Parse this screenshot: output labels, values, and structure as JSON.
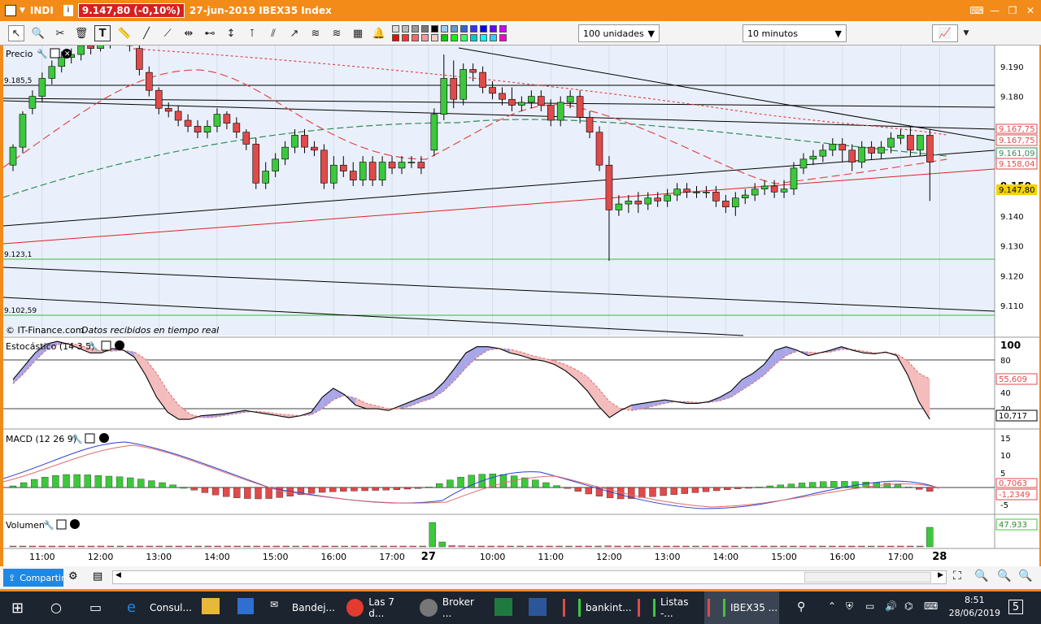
{
  "titlebar": {
    "ticker": "INDI",
    "price_badge": "9.147,80 (-0,10%)",
    "title": "27-jun-2019 IBEX35 Index"
  },
  "toolbar": {
    "quantity_select": "100 unidades",
    "interval_select": "10 minutos"
  },
  "panels": {
    "price": {
      "label": "Precio",
      "credit": "© IT-Finance.com",
      "credit_italic": "Datos recibidos en tiempo real",
      "level_labels": [
        "9.185,5",
        "9.123,1",
        "9.102,59"
      ],
      "axis_ticks": [
        "9.190",
        "9.180",
        "9.170",
        "9.160",
        "9.150",
        "9.140",
        "9.130",
        "9.120",
        "9.110"
      ],
      "value_tags": [
        "9.167,75",
        "9.167,75",
        "9.161,09",
        "9.158,04",
        "9.147,80"
      ]
    },
    "stoch": {
      "label": "Estocástico (14 3 5)",
      "axis_ticks": [
        "100",
        "80",
        "40",
        "20"
      ],
      "value_tags": [
        "55,609",
        "10,717"
      ]
    },
    "macd": {
      "label": "MACD (12 26 9)",
      "axis_ticks": [
        "15",
        "10",
        "5",
        "-5"
      ],
      "value_tags": [
        "0,7063",
        "-1,2349"
      ]
    },
    "volume": {
      "label": "Volumen",
      "value_tag": "47.933"
    }
  },
  "time_axis": {
    "labels": [
      "11:00",
      "12:00",
      "13:00",
      "14:00",
      "15:00",
      "16:00",
      "17:00",
      "27",
      "10:00",
      "11:00",
      "12:00",
      "13:00",
      "14:00",
      "15:00",
      "16:00",
      "17:00",
      "28"
    ]
  },
  "bottombar": {
    "share_label": "Compartir"
  },
  "taskbar": {
    "items": [
      "Consul...",
      "Bandej...",
      "Las 7 d...",
      "Broker ...",
      "bankint...",
      "Listas -...",
      "IBEX35 ..."
    ],
    "time": "8:51",
    "date": "28/06/2019",
    "notif_count": "5"
  },
  "colors": {
    "up": "#3cc83c",
    "down": "#e04a4a",
    "chart_bg": "#eaf0fb",
    "accent_orange": "#f28b17"
  },
  "chart_data": [
    {
      "type": "candlestick",
      "title": "Precio",
      "ylim": [
        9100,
        9197
      ],
      "x": [
        "26-jun 10:30",
        "10:40",
        "10:50",
        "11:00",
        "11:10",
        "11:20",
        "11:30",
        "11:40",
        "11:50",
        "12:00",
        "12:10",
        "12:20",
        "12:30",
        "12:40",
        "12:50",
        "13:00",
        "13:10",
        "13:20",
        "13:30",
        "13:40",
        "13:50",
        "14:00",
        "14:10",
        "14:20",
        "14:30",
        "14:40",
        "14:50",
        "15:00",
        "15:10",
        "15:20",
        "15:30",
        "15:40",
        "15:50",
        "16:00",
        "16:10",
        "16:20",
        "16:30",
        "16:40",
        "16:50",
        "17:00",
        "17:10",
        "17:20",
        "17:30",
        "27-jun 09:00",
        "09:10",
        "09:20",
        "09:30",
        "09:40",
        "09:50",
        "10:00",
        "10:10",
        "10:20",
        "10:30",
        "10:40",
        "10:50",
        "11:00",
        "11:10",
        "11:20",
        "11:30",
        "11:40",
        "11:50",
        "12:00",
        "12:10",
        "12:20",
        "12:30",
        "12:40",
        "12:50",
        "13:00",
        "13:10",
        "13:20",
        "13:30",
        "13:40",
        "13:50",
        "14:00",
        "14:10",
        "14:20",
        "14:30",
        "14:40",
        "14:50",
        "15:00",
        "15:10",
        "15:20",
        "15:30",
        "15:40",
        "15:50",
        "16:00",
        "16:10",
        "16:20",
        "16:30",
        "16:40",
        "16:50",
        "17:00",
        "17:10",
        "17:20",
        "17:30"
      ],
      "open": [
        9157,
        9163,
        9176,
        9180,
        9186,
        9190,
        9193,
        9194,
        9197,
        9196,
        9198,
        9200,
        9199,
        9196,
        9188,
        9182,
        9176,
        9175,
        9172,
        9170,
        9168,
        9170,
        9174,
        9171,
        9168,
        9164,
        9151,
        9155,
        9159,
        9163,
        9167,
        9163,
        9162,
        9151,
        9157,
        9155,
        9152,
        9158,
        9152,
        9158,
        9156,
        9158,
        9158,
        9162,
        9174,
        9186,
        9179,
        9189,
        9188,
        9183,
        9181,
        9179,
        9177,
        9178,
        9180,
        9177,
        9172,
        9178,
        9180,
        9173,
        9168,
        9157,
        9142,
        9144,
        9145,
        9144,
        9146,
        9145,
        9147,
        9149,
        9148,
        9148,
        9148,
        9145,
        9143,
        9146,
        9147,
        9149,
        9150,
        9148,
        9149,
        9156,
        9159,
        9160,
        9162,
        9164,
        9162,
        9158,
        9163,
        9161,
        9163,
        9166,
        9167,
        9162,
        9167
      ],
      "close": [
        9163,
        9174,
        9180,
        9186,
        9190,
        9193,
        9194,
        9197,
        9196,
        9198,
        9201,
        9200,
        9197,
        9189,
        9182,
        9176,
        9175,
        9172,
        9170,
        9168,
        9170,
        9174,
        9171,
        9168,
        9164,
        9151,
        9155,
        9159,
        9163,
        9167,
        9163,
        9162,
        9151,
        9157,
        9155,
        9152,
        9158,
        9152,
        9158,
        9156,
        9158,
        9158,
        9156,
        9174,
        9186,
        9179,
        9189,
        9188,
        9183,
        9181,
        9179,
        9177,
        9178,
        9180,
        9177,
        9172,
        9178,
        9180,
        9173,
        9168,
        9157,
        9142,
        9144,
        9145,
        9144,
        9146,
        9145,
        9147,
        9149,
        9148,
        9148,
        9148,
        9145,
        9143,
        9146,
        9147,
        9149,
        9150,
        9148,
        9149,
        9156,
        9159,
        9160,
        9162,
        9164,
        9162,
        9158,
        9163,
        9161,
        9163,
        9166,
        9167,
        9162,
        9167,
        9158
      ],
      "high": [
        9164,
        9175,
        9182,
        9188,
        9192,
        9195,
        9196,
        9198,
        9199,
        9199,
        9202,
        9201,
        9200,
        9197,
        9190,
        9183,
        9178,
        9177,
        9174,
        9172,
        9172,
        9176,
        9175,
        9173,
        9169,
        9166,
        9158,
        9161,
        9165,
        9169,
        9169,
        9165,
        9164,
        9160,
        9160,
        9158,
        9160,
        9160,
        9160,
        9160,
        9160,
        9160,
        9160,
        9176,
        9194,
        9192,
        9191,
        9191,
        9190,
        9185,
        9183,
        9183,
        9180,
        9182,
        9182,
        9179,
        9180,
        9182,
        9182,
        9175,
        9170,
        9160,
        9147,
        9147,
        9148,
        9148,
        9148,
        9149,
        9151,
        9151,
        9150,
        9150,
        9150,
        9147,
        9148,
        9149,
        9151,
        9152,
        9152,
        9152,
        9158,
        9161,
        9162,
        9164,
        9166,
        9166,
        9164,
        9165,
        9165,
        9165,
        9168,
        9169,
        9170,
        9166,
        9169
      ],
      "low": [
        9155,
        9161,
        9174,
        9178,
        9184,
        9188,
        9191,
        9192,
        9194,
        9195,
        9196,
        9198,
        9195,
        9187,
        9180,
        9174,
        9173,
        9170,
        9168,
        9166,
        9166,
        9168,
        9169,
        9166,
        9162,
        9149,
        9149,
        9153,
        9157,
        9161,
        9161,
        9160,
        9149,
        9149,
        9153,
        9150,
        9150,
        9150,
        9150,
        9154,
        9154,
        9156,
        9154,
        9160,
        9172,
        9176,
        9177,
        9185,
        9181,
        9179,
        9177,
        9175,
        9175,
        9176,
        9175,
        9170,
        9170,
        9176,
        9171,
        9166,
        9155,
        9125,
        9140,
        9141,
        9141,
        9142,
        9143,
        9143,
        9145,
        9146,
        9146,
        9146,
        9143,
        9141,
        9140,
        9144,
        9145,
        9147,
        9146,
        9146,
        9147,
        9154,
        9157,
        9158,
        9160,
        9158,
        9155,
        9156,
        9159,
        9159,
        9161,
        9164,
        9160,
        9160,
        9145
      ]
    },
    {
      "type": "line",
      "title": "Estocástico (14 3 5)",
      "ylim": [
        0,
        100
      ],
      "series": [
        {
          "values": [
            55,
            70,
            85,
            95,
            98,
            95,
            90,
            85,
            85,
            90,
            88,
            80,
            60,
            35,
            18,
            10,
            10,
            14,
            15,
            16,
            18,
            20,
            18,
            16,
            14,
            12,
            14,
            18,
            35,
            45,
            38,
            26,
            22,
            22,
            20,
            25,
            30,
            35,
            40,
            52,
            68,
            85,
            92,
            92,
            90,
            85,
            82,
            78,
            76,
            72,
            65,
            55,
            42,
            25,
            12,
            20,
            26,
            28,
            30,
            32,
            30,
            28,
            28,
            30,
            35,
            42,
            55,
            62,
            72,
            88,
            92,
            88,
            82,
            85,
            88,
            92,
            88,
            85,
            84,
            86,
            82,
            60,
            30,
            10
          ]
        },
        {
          "values": [
            50,
            62,
            76,
            88,
            94,
            96,
            94,
            90,
            87,
            87,
            88,
            86,
            78,
            62,
            42,
            26,
            16,
            12,
            12,
            14,
            16,
            18,
            19,
            18,
            16,
            15,
            14,
            15,
            22,
            32,
            37,
            34,
            28,
            25,
            22,
            22,
            25,
            30,
            34,
            42,
            54,
            68,
            80,
            88,
            90,
            89,
            86,
            82,
            79,
            76,
            72,
            66,
            58,
            45,
            30,
            22,
            20,
            22,
            25,
            28,
            30,
            30,
            29,
            29,
            31,
            35,
            43,
            51,
            60,
            72,
            82,
            87,
            86,
            85,
            86,
            89,
            89,
            87,
            85,
            85,
            84,
            76,
            62,
            55.6
          ]
        }
      ],
      "reference_lines": [
        80,
        20
      ]
    },
    {
      "type": "bar",
      "title": "MACD (12 26 9)",
      "ylim": [
        -7,
        17
      ],
      "values": [
        0.5,
        1.5,
        2.5,
        3.2,
        3.7,
        4,
        4,
        3.9,
        3.7,
        3.5,
        3.3,
        3,
        2.6,
        2.1,
        1.5,
        0.8,
        0,
        -0.8,
        -1.6,
        -2.3,
        -2.8,
        -3.2,
        -3.4,
        -3.5,
        -3.4,
        -3.1,
        -2.7,
        -2.2,
        -1.8,
        -1.5,
        -1.3,
        -1.2,
        -1.1,
        -1,
        -0.9,
        -0.8,
        -0.7,
        -0.5,
        -0.3,
        0.2,
        1.2,
        2.3,
        3.2,
        3.8,
        4.1,
        4.2,
        4,
        3.6,
        3,
        2.3,
        1.5,
        0.6,
        -0.3,
        -1.2,
        -2,
        -2.7,
        -3.2,
        -3.5,
        -3.4,
        -3.1,
        -2.8,
        -2.5,
        -2.2,
        -1.9,
        -1.6,
        -1.3,
        -1,
        -0.7,
        -0.4,
        -0.1,
        0.2,
        0.5,
        0.8,
        1.1,
        1.4,
        1.6,
        1.8,
        1.9,
        1.9,
        1.8,
        1.7,
        1.5,
        1.3,
        0.9,
        0.2,
        -0.6,
        -1.2
      ]
    },
    {
      "type": "bar",
      "title": "Volumen",
      "values": [
        0.3,
        0.2,
        0.2,
        0.3,
        0.2,
        0.2,
        0.2,
        0.2,
        0.3,
        0.2,
        0.2,
        0.2,
        0.2,
        0.2,
        0.2,
        0.2,
        0.3,
        0.2,
        0.2,
        0.2,
        0.2,
        0.2,
        0.2,
        0.2,
        0.2,
        0.2,
        0.2,
        0.2,
        0.2,
        0.2,
        0.2,
        0.2,
        0.2,
        0.2,
        0.3,
        0.2,
        0.2,
        0.2,
        0.2,
        0.2,
        0.2,
        0.3,
        0.2,
        10,
        2,
        0.5,
        0.4,
        0.3,
        0.3,
        0.3,
        0.2,
        0.2,
        0.3,
        0.2,
        0.2,
        0.2,
        0.3,
        0.2,
        0.2,
        0.2,
        0.2,
        0.4,
        0.2,
        0.2,
        0.2,
        0.2,
        0.2,
        0.2,
        0.2,
        0.2,
        0.2,
        0.2,
        0.2,
        0.2,
        0.2,
        0.2,
        0.2,
        0.2,
        0.2,
        0.2,
        0.2,
        0.2,
        0.2,
        0.2,
        0.2,
        0.2,
        0.2,
        0.2,
        0.2,
        0.2,
        0.2,
        0.2,
        0.2,
        0.3,
        8
      ]
    }
  ]
}
